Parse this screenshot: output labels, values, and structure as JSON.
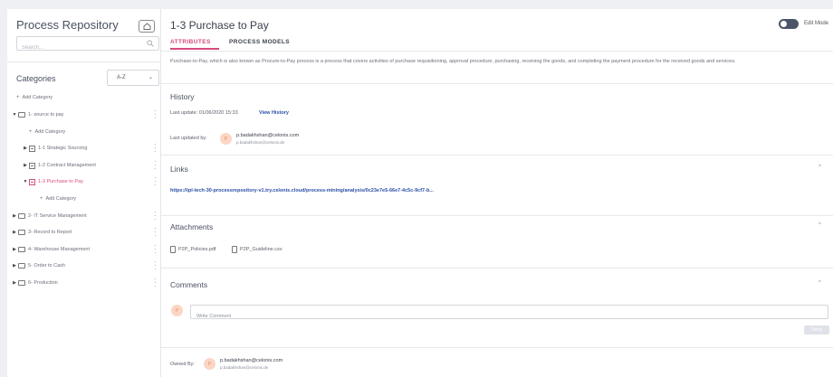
{
  "sidebar": {
    "title": "Process Repository",
    "search_placeholder": "Search...",
    "categories_label": "Categories",
    "sort_value": "A-Z",
    "add_category": "Add Category",
    "tree": [
      {
        "label": "1- source to pay",
        "kind": "folder",
        "depth": 0,
        "state": "open"
      },
      {
        "label": "Add Category",
        "kind": "add",
        "depth": 1
      },
      {
        "label": "1-1 Strategic Sourcing",
        "kind": "process",
        "depth": 1,
        "state": "closed"
      },
      {
        "label": "1-2 Contract Management",
        "kind": "process",
        "depth": 1,
        "state": "closed"
      },
      {
        "label": "1-3 Purchase to Pay",
        "kind": "process",
        "depth": 1,
        "state": "open",
        "active": true
      },
      {
        "label": "Add Category",
        "kind": "add",
        "depth": 2
      },
      {
        "label": "2- IT Service Management",
        "kind": "folder",
        "depth": 0,
        "state": "closed"
      },
      {
        "label": "3- Record to Report",
        "kind": "folder",
        "depth": 0,
        "state": "closed"
      },
      {
        "label": "4- Warehouse Management",
        "kind": "folder",
        "depth": 0,
        "state": "closed"
      },
      {
        "label": "5- Order to Cash",
        "kind": "folder",
        "depth": 0,
        "state": "closed"
      },
      {
        "label": "6- Production",
        "kind": "folder",
        "depth": 0,
        "state": "closed"
      }
    ]
  },
  "main": {
    "title": "1-3 Purchase to Pay",
    "edit_mode_label": "Edit Mode",
    "tabs": [
      {
        "label": "ATTRIBUTES",
        "active": true
      },
      {
        "label": "PROCESS MODELS",
        "active": false
      }
    ],
    "description": "Purchase-to-Pay, which is also known as Procure-to-Pay process is a process that covers activities of purchase requisitioning, approval procedure, purchasing, receiving the goods, and completing the payment procedure for the received goods and services.",
    "history": {
      "title": "History",
      "last_update_label": "Last update:",
      "last_update_value": "01/06/2020 15:33",
      "view_history": "View History",
      "last_updated_by_label": "Last updated by:",
      "avatar_initial": "P",
      "email": "p.badakhshan@celonis.com",
      "email_sub": "p.badakhshan@celonis.de"
    },
    "links": {
      "title": "Links",
      "url": "https://ipl-tech-30-processrepository-v1.try.celonis.cloud/process-mining/analysis/0c23e7e5-66e7-4c5c-9cf7-b..."
    },
    "attachments": {
      "title": "Attachments",
      "files": [
        "P2P_Policies.pdf",
        "P2P_Guideline.csv"
      ]
    },
    "comments": {
      "title": "Comments",
      "avatar_initial": "P",
      "placeholder": "Write Comment",
      "send_label": "Send"
    },
    "owner": {
      "label": "Owned By:",
      "avatar_initial": "P",
      "email": "p.badakhshan@celonis.com",
      "email_sub": "p.badakhshan@celonis.de"
    }
  },
  "colors": {
    "accent": "#d64b7e",
    "link": "#2a4fa8",
    "avatar_bg": "#fbd6c4"
  }
}
